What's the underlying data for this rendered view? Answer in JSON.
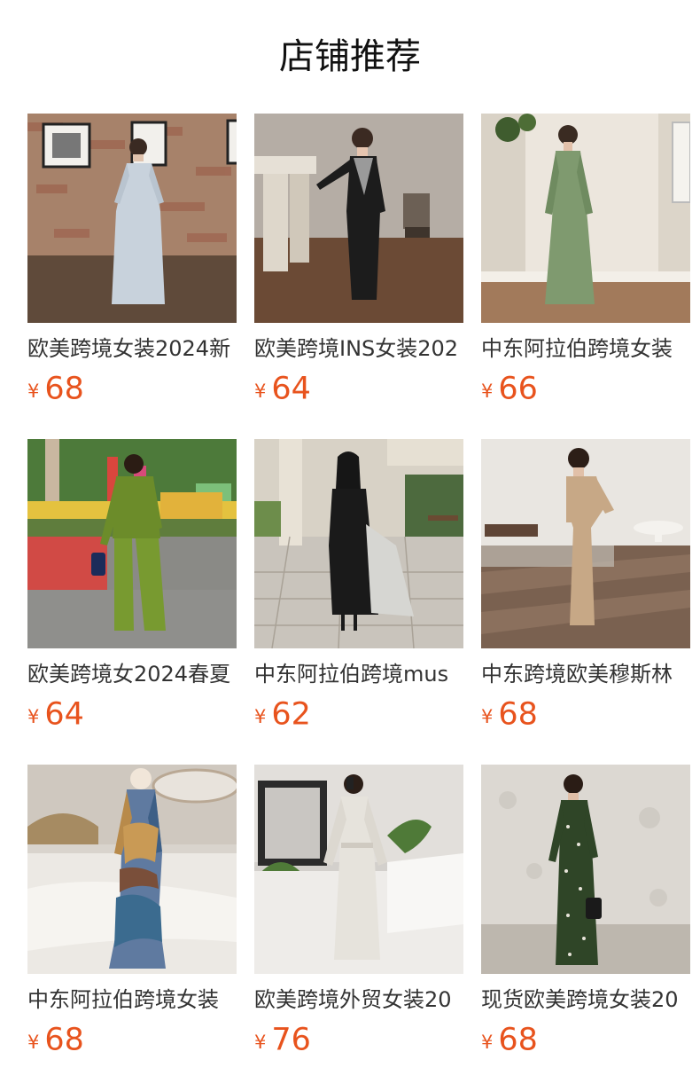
{
  "section": {
    "title": "店铺推荐"
  },
  "colors": {
    "price": "#e8531d",
    "title_text": "#333333"
  },
  "products": [
    {
      "title": "欧美跨境女装2024新",
      "currency": "¥",
      "price": "68",
      "image": "woman-in-light-blue-gown-brick-wall"
    },
    {
      "title": "欧美跨境INS女装202",
      "currency": "¥",
      "price": "64",
      "image": "woman-in-black-dress-with-fireplace"
    },
    {
      "title": "中东阿拉伯跨境女装",
      "currency": "¥",
      "price": "66",
      "image": "woman-in-sage-satin-dress"
    },
    {
      "title": "欧美跨境女2024春夏",
      "currency": "¥",
      "price": "64",
      "image": "woman-in-green-shirt-and-pants-outdoors"
    },
    {
      "title": "中东阿拉伯跨境mus",
      "currency": "¥",
      "price": "62",
      "image": "woman-in-black-hijab-outfit-courtyard"
    },
    {
      "title": "中东跨境欧美穆斯林",
      "currency": "¥",
      "price": "68",
      "image": "woman-in-beige-dress-interior"
    },
    {
      "title": "中东阿拉伯跨境女装",
      "currency": "¥",
      "price": "68",
      "image": "woman-in-printed-dress-bedroom"
    },
    {
      "title": "欧美跨境外贸女装20",
      "currency": "¥",
      "price": "76",
      "image": "woman-in-white-satin-dress-mirror-selfie"
    },
    {
      "title": "现货欧美跨境女装20",
      "currency": "¥",
      "price": "68",
      "image": "woman-in-dark-green-embellished-dress"
    }
  ]
}
